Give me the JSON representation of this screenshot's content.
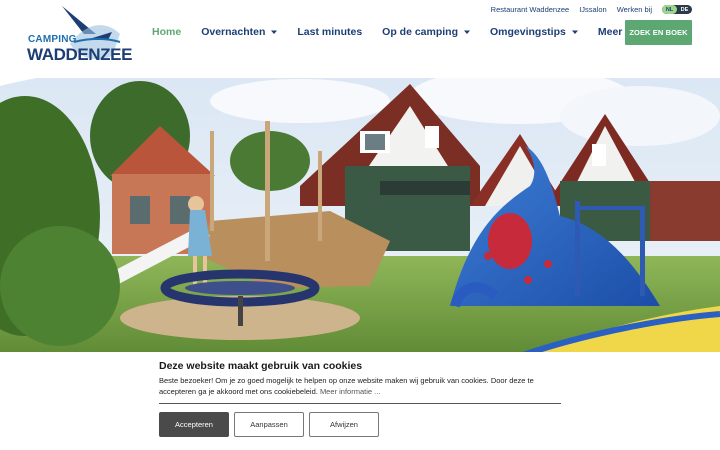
{
  "logo": {
    "line1": "CAMPING",
    "line2": "WADDENZEE"
  },
  "topbar": {
    "links": [
      "Restaurant Waddenzee",
      "IJssalon",
      "Werken bij"
    ],
    "languages": [
      "NL",
      "DE"
    ],
    "active_language": "NL"
  },
  "nav": {
    "items": [
      {
        "label": "Home",
        "dropdown": false,
        "active": true
      },
      {
        "label": "Overnachten",
        "dropdown": true
      },
      {
        "label": "Last minutes",
        "dropdown": false
      },
      {
        "label": "Op de camping",
        "dropdown": true
      },
      {
        "label": "Omgevingstips",
        "dropdown": true
      },
      {
        "label": "Meer info",
        "dropdown": true
      }
    ],
    "cta": "ZOEK EN BOEK"
  },
  "cookie": {
    "title": "Deze website maakt gebruik van cookies",
    "text": "Beste bezoeker! Om je zo goed mogelijk te helpen op onze website maken wij gebruik van cookies. Door deze te accepteren ga je akkoord met ons cookiebeleid.",
    "more": "Meer informatie ...",
    "accept": "Accepteren",
    "adjust": "Aanpassen",
    "reject": "Afwijzen"
  },
  "colors": {
    "navy": "#1d3e74",
    "green": "#5da872",
    "accent_blue": "#1d6fb0",
    "button_dark": "#4a4a4a"
  }
}
